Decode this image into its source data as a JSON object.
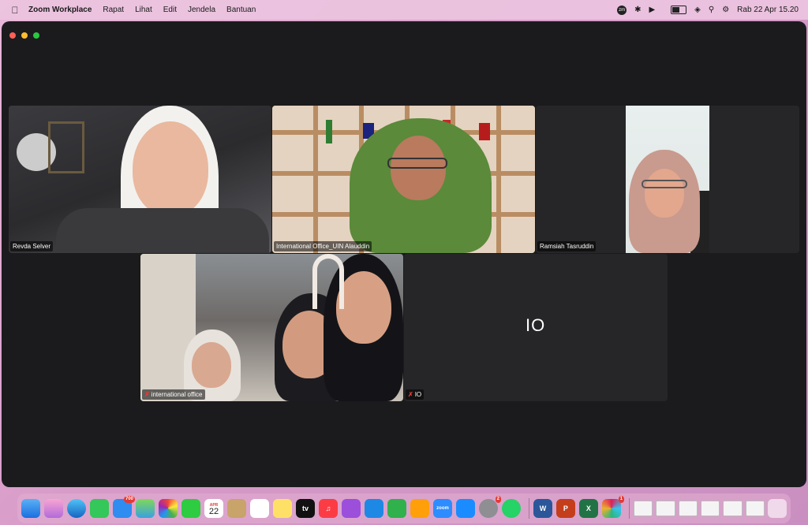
{
  "menubar": {
    "app_name": "Zoom Workplace",
    "menus": [
      "Rapat",
      "Lihat",
      "Edit",
      "Jendela",
      "Bantuan"
    ],
    "status_icons": [
      "zoom-icon",
      "bluetooth-icon",
      "play-icon",
      "battery-icon",
      "wifi-icon",
      "search-icon",
      "control-center-icon"
    ],
    "zoom_badge": "zm",
    "datetime": "Rab 22 Apr  15.20"
  },
  "participants": [
    {
      "name": "Revda Selver"
    },
    {
      "name": "International Office_UIN Alauddin"
    },
    {
      "name": "Ramsiah Tasruddin"
    },
    {
      "name": "international office"
    },
    {
      "name": "IO",
      "initials": "IO"
    }
  ],
  "dock": {
    "mail_badge": "700",
    "settings_badge": "2",
    "slack_badge": "1",
    "calendar_month": "APR",
    "calendar_day": "22",
    "tv_label": "tv",
    "zoom_label": "zoom"
  },
  "colors": {
    "active_speaker": "#4caf50",
    "muted_mic": "#e53935",
    "window_bg": "#1b1b1d"
  }
}
